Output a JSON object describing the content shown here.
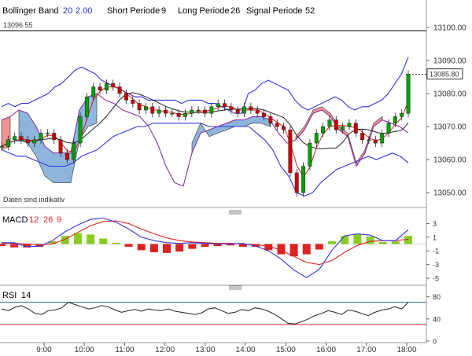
{
  "header": {
    "indicator": "Bollinger Band",
    "bb_period": "20",
    "bb_dev": "2.00",
    "short_label": "Short Periode",
    "short_val": "9",
    "long_label": "Long Periode",
    "long_val": "26",
    "signal_label": "Signal Periode",
    "signal_val": "52"
  },
  "price": {
    "ref_line": "13096.55",
    "last_price": "13085.80",
    "note": "Daten sind indikativ"
  },
  "macd_header": {
    "label": "MACD",
    "p1": "12",
    "p2": "26",
    "p3": "9"
  },
  "rsi_header": {
    "label": "RSI",
    "p1": "14"
  },
  "colors": {
    "up": "#00a000",
    "down": "#d00000",
    "boll": "#3333dd",
    "signal": "#8833aa",
    "cloud_blue": "#7aa9d6",
    "cloud_red": "#f08080",
    "macd_line": "#3333dd",
    "signal_line": "#dd2222",
    "hist_pos": "#88cc22",
    "hist_neg": "#dd2222",
    "rsi_line": "#222222",
    "rsi_upper": "#226688",
    "rsi_lower": "#dd2222"
  },
  "chart_data": [
    {
      "type": "line",
      "name_panel": "price",
      "x_ticks": [
        "9:00",
        "10:00",
        "11:00",
        "12:00",
        "13:00",
        "14:00",
        "15:00",
        "16:00",
        "17:00",
        "18:00"
      ],
      "y_ticks": [
        13050,
        13060,
        13070,
        13080,
        13090,
        13100
      ],
      "ylim": [
        13046,
        13104
      ],
      "ref_value": 13096.55,
      "last_value": 13085.8,
      "candles_close": [
        13064,
        13066,
        13067,
        13066,
        13065,
        13066,
        13068,
        13068,
        13066,
        13062,
        13060,
        13065,
        13073,
        13079,
        13082,
        13081,
        13083,
        13082,
        13080,
        13078,
        13077,
        13075,
        13076,
        13074,
        13075,
        13074,
        13074,
        13073,
        13074,
        13075,
        13075,
        13074,
        13076,
        13077,
        13076,
        13075,
        13074,
        13076,
        13075,
        13074,
        13073,
        13071,
        13070,
        13069,
        13056,
        13050,
        13058,
        13065,
        13068,
        13070,
        13072,
        13069,
        13070,
        13071,
        13068,
        13066,
        13066,
        13065,
        13068,
        13071,
        13073,
        13074,
        13085.8
      ],
      "bollinger_upper": [
        13076,
        13077,
        13076,
        13077,
        13077,
        13078,
        13079,
        13080,
        13082,
        13083,
        13085,
        13087,
        13088,
        13087,
        13086,
        13084,
        13083,
        13082,
        13081,
        13080,
        13079,
        13079,
        13078,
        13078,
        13078,
        13078,
        13078,
        13077,
        13078,
        13078,
        13078,
        13077,
        13077,
        13076,
        13075,
        13074,
        13074,
        13080,
        13081,
        13083,
        13084,
        13083,
        13082,
        13081,
        13078,
        13076,
        13075,
        13076,
        13077,
        13078,
        13079,
        13078,
        13076,
        13075,
        13076,
        13076,
        13077,
        13078,
        13080,
        13083,
        13086,
        13091
      ],
      "bollinger_lower": [
        13063,
        13062,
        13061,
        13061,
        13060,
        13059,
        13058,
        13058,
        13058,
        13059,
        13061,
        13062,
        13063,
        13065,
        13067,
        13068,
        13069,
        13070,
        13070,
        13071,
        13071,
        13071,
        13071,
        13071,
        13071,
        13071,
        13070,
        13070,
        13070,
        13070,
        13070,
        13070,
        13068,
        13066,
        13063,
        13058,
        13055,
        13050,
        13049,
        13050,
        13053,
        13055,
        13057,
        13058,
        13059,
        13060,
        13061,
        13060,
        13061,
        13062,
        13061,
        13059
      ],
      "ichimoku_signal": [
        13072,
        13073,
        13075,
        13074,
        13070,
        13064,
        13062,
        13062,
        13062,
        13075,
        13079,
        13080,
        13078,
        13077,
        13075,
        13074,
        13073,
        13070,
        13065,
        13058,
        13053,
        13052,
        13062,
        13068,
        13069,
        13070,
        13071,
        13072,
        13072,
        13073,
        13073,
        13072,
        13068,
        13065,
        13066,
        13069,
        13074,
        13075,
        13073,
        13069,
        13067,
        13058,
        13062,
        13070,
        13072,
        13071,
        13070,
        13068
      ]
    },
    {
      "type": "line",
      "name_panel": "macd",
      "y_ticks": [
        3,
        1,
        -1,
        -3,
        -5
      ],
      "ylim": [
        -5.8,
        4.2
      ],
      "macd_line": [
        0.2,
        0.2,
        -0.4,
        -0.3,
        0.5,
        1.8,
        2.8,
        3.6,
        3.8,
        3.2,
        2.2,
        1.0,
        0.5,
        0.2,
        0.1,
        0.2,
        0.1,
        0.0,
        0.0,
        0.1,
        -0.3,
        -1.0,
        -2.2,
        -3.8,
        -4.9,
        -3.7,
        -0.9,
        1.2,
        1.5,
        1.3,
        0.5,
        0.5,
        2.1
      ],
      "signal_line": [
        0.1,
        0.1,
        0.0,
        -0.1,
        0.0,
        0.7,
        1.7,
        2.7,
        3.3,
        3.4,
        3.0,
        2.2,
        1.5,
        0.9,
        0.5,
        0.3,
        0.2,
        0.1,
        0.1,
        0.0,
        -0.1,
        -0.3,
        -0.9,
        -1.8,
        -2.7,
        -3.0,
        -2.4,
        -1.2,
        -0.2,
        0.4,
        0.5,
        0.5,
        0.7
      ],
      "histogram": [
        -0.3,
        -0.5,
        -0.5,
        -0.4,
        0.4,
        1.2,
        1.6,
        1.4,
        0.8,
        0.2,
        -0.4,
        -0.9,
        -1.2,
        -1.3,
        -1.1,
        -0.7,
        -0.4,
        -0.3,
        -0.2,
        -0.4,
        -0.4,
        -0.9,
        -1.5,
        -1.8,
        -1.5,
        -0.8,
        0.4,
        1.2,
        1.5,
        1.1,
        0.3,
        0.4,
        1.2
      ]
    },
    {
      "type": "line",
      "name_panel": "rsi",
      "y_ticks": [
        80,
        40,
        0
      ],
      "ylim": [
        0,
        88
      ],
      "upper_level": 70,
      "lower_level": 30,
      "rsi": [
        58,
        55,
        61,
        64,
        58,
        50,
        48,
        55,
        56,
        60,
        70,
        66,
        62,
        58,
        60,
        64,
        62,
        56,
        52,
        55,
        57,
        54,
        58,
        56,
        55,
        58,
        54,
        52,
        50,
        48,
        51,
        58,
        60,
        55,
        50,
        52,
        57,
        55,
        60,
        58,
        54,
        48,
        40,
        32,
        31,
        35,
        40,
        46,
        50,
        55,
        52,
        48,
        56,
        54,
        50,
        46,
        52,
        56,
        58,
        62,
        58,
        70
      ]
    }
  ]
}
